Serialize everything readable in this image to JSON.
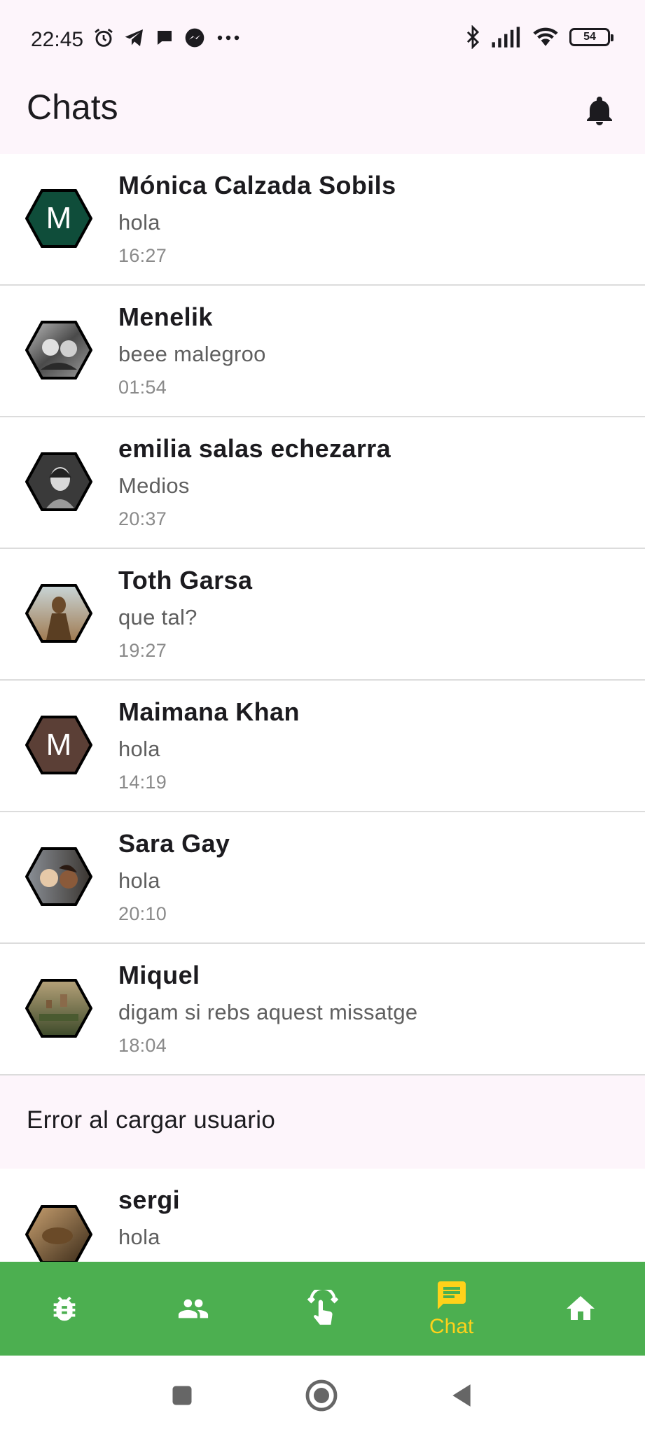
{
  "status_bar": {
    "time": "22:45",
    "battery": "54",
    "left_icons": [
      "alarm-icon",
      "telegram-icon",
      "message-bubble-icon",
      "messenger-icon",
      "more-dots-icon"
    ],
    "right_icons": [
      "bluetooth-icon",
      "signal-icon",
      "wifi-icon",
      "battery-icon"
    ]
  },
  "app_bar": {
    "title": "Chats",
    "action_icon": "bell-icon"
  },
  "chats": [
    {
      "name": "Mónica Calzada Sobils",
      "message": "hola",
      "time": "16:27",
      "avatar_letter": "M",
      "avatar_color": "#0f4d3a"
    },
    {
      "name": "Menelik",
      "message": "beee malegroo",
      "time": "01:54",
      "avatar_letter": "",
      "avatar_color": "#6b6b6b"
    },
    {
      "name": "emilia salas echezarra",
      "message": "Medios",
      "time": "20:37",
      "avatar_letter": "",
      "avatar_color": "#5a5a5a"
    },
    {
      "name": "Toth Garsa",
      "message": "que tal?",
      "time": "19:27",
      "avatar_letter": "",
      "avatar_color": "#8a6a45"
    },
    {
      "name": "Maimana Khan",
      "message": "hola",
      "time": "14:19",
      "avatar_letter": "M",
      "avatar_color": "#5b3f36"
    },
    {
      "name": "Sara Gay",
      "message": "hola",
      "time": "20:10",
      "avatar_letter": "",
      "avatar_color": "#4a4a52"
    },
    {
      "name": "Miquel",
      "message": "digam si rebs aquest missatge",
      "time": "18:04",
      "avatar_letter": "",
      "avatar_color": "#6b5a3a"
    }
  ],
  "error_row": {
    "text": "Error al cargar usuario"
  },
  "partial_chat": {
    "name": "sergi",
    "message": "hola",
    "avatar_letter": "",
    "avatar_color": "#7a5a30"
  },
  "bottom_nav": {
    "items": [
      {
        "icon": "bug-icon",
        "label": ""
      },
      {
        "icon": "people-icon",
        "label": ""
      },
      {
        "icon": "touch-swipe-icon",
        "label": ""
      },
      {
        "icon": "chat-icon",
        "label": "Chat",
        "active": true
      },
      {
        "icon": "home-icon",
        "label": ""
      }
    ],
    "background": "#4caf50",
    "active_color": "#ffd21a"
  },
  "system_nav": {
    "icons": [
      "recents-square-icon",
      "home-circle-icon",
      "back-triangle-icon"
    ]
  }
}
